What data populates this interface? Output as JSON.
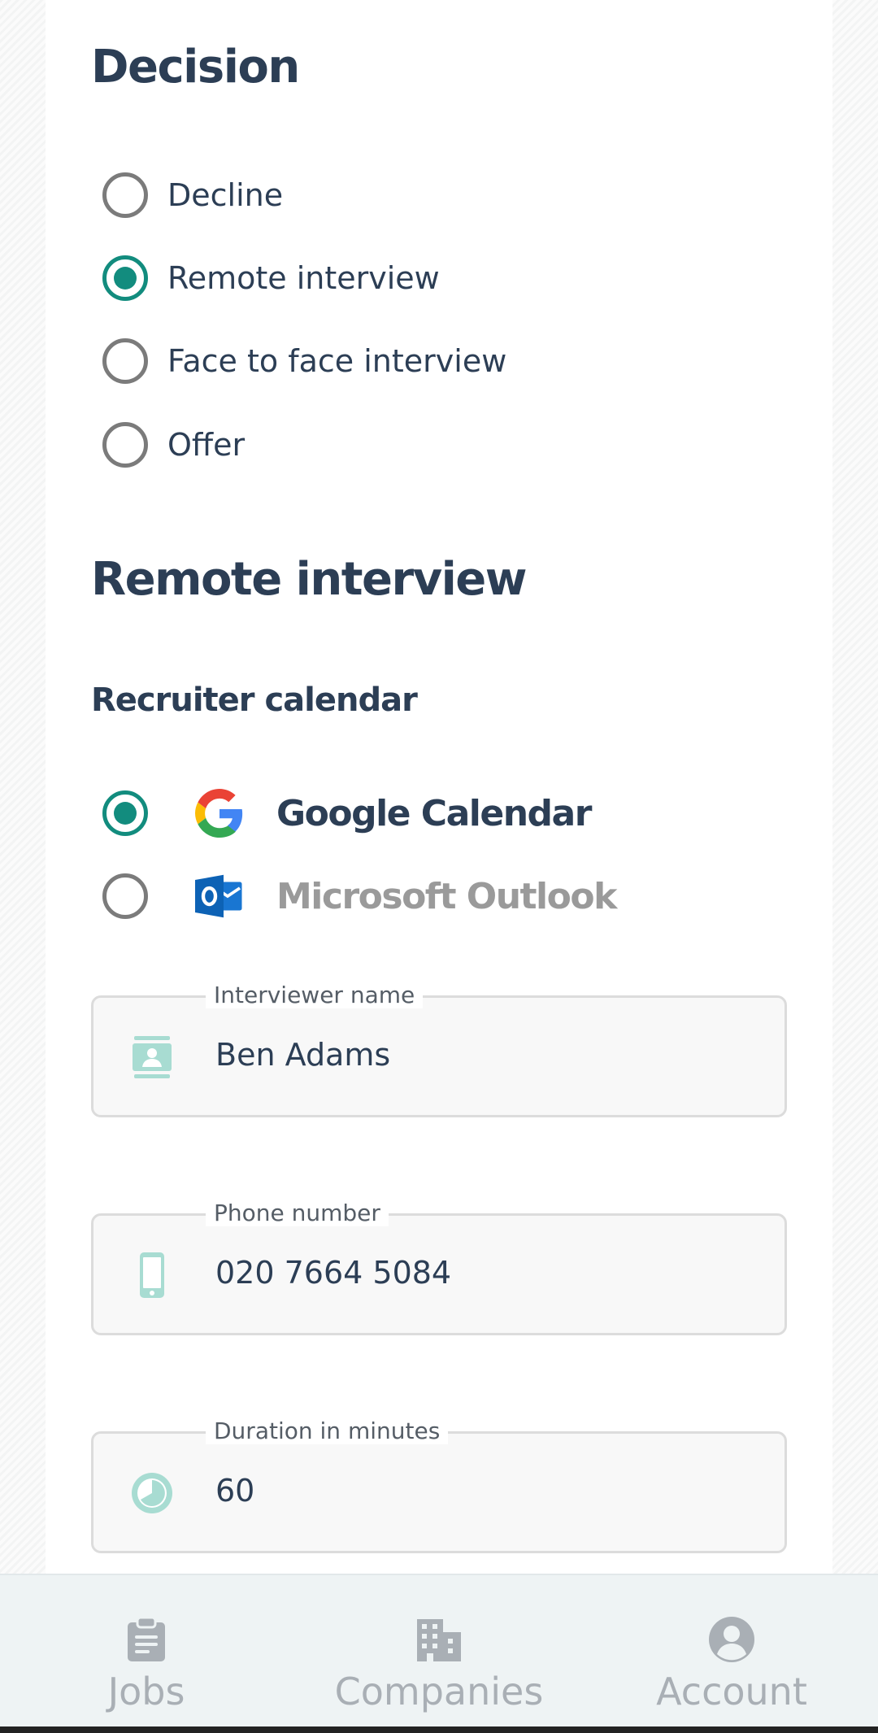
{
  "decision": {
    "heading": "Decision",
    "options": [
      {
        "label": "Decline",
        "checked": false
      },
      {
        "label": "Remote interview",
        "checked": true
      },
      {
        "label": "Face to face interview",
        "checked": false
      },
      {
        "label": "Offer",
        "checked": false
      }
    ]
  },
  "remote_interview": {
    "heading": "Remote interview",
    "calendar_heading": "Recruiter calendar",
    "calendars": [
      {
        "label": "Google Calendar",
        "icon": "google-logo-icon",
        "checked": true
      },
      {
        "label": "Microsoft Outlook",
        "icon": "outlook-logo-icon",
        "checked": false
      }
    ],
    "fields": {
      "interviewer_name": {
        "label": "Interviewer name",
        "value": "Ben Adams",
        "icon": "contact-card-icon"
      },
      "phone_number": {
        "label": "Phone number",
        "value": "020 7664 5084",
        "icon": "mobile-phone-icon"
      },
      "duration": {
        "label": "Duration in minutes",
        "value": "60",
        "icon": "clock-icon"
      }
    }
  },
  "bottom_nav": {
    "items": [
      {
        "label": "Jobs",
        "icon": "clipboard-icon"
      },
      {
        "label": "Companies",
        "icon": "building-icon"
      },
      {
        "label": "Account",
        "icon": "user-circle-icon"
      }
    ]
  },
  "colors": {
    "accent": "#128c7e",
    "icon_tint": "#a8dcd2",
    "heading": "#2c3e55",
    "nav_inactive": "#a9afb5"
  }
}
